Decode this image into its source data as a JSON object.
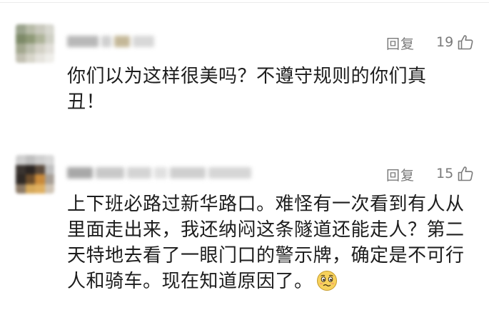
{
  "comments": [
    {
      "reply_label": "回复",
      "like_count": "19",
      "text": "你们以为这样很美吗？不遵守规则的你们真丑！"
    },
    {
      "reply_label": "回复",
      "like_count": "15",
      "text": "上下班必路过新华路口。难怪有一次看到有人从里面走出来，我还纳闷这条隧道还能走人？第二天特地去看了一眼门口的警示牌，确定是不可行人和骑车。现在知道原因了。",
      "trailing_emoji": "worried-face-emoji"
    }
  ],
  "icons": {
    "like": "thumbs-up-icon"
  },
  "colors": {
    "secondary_text": "#7a7a7a",
    "body_text": "#1d1d1d"
  }
}
